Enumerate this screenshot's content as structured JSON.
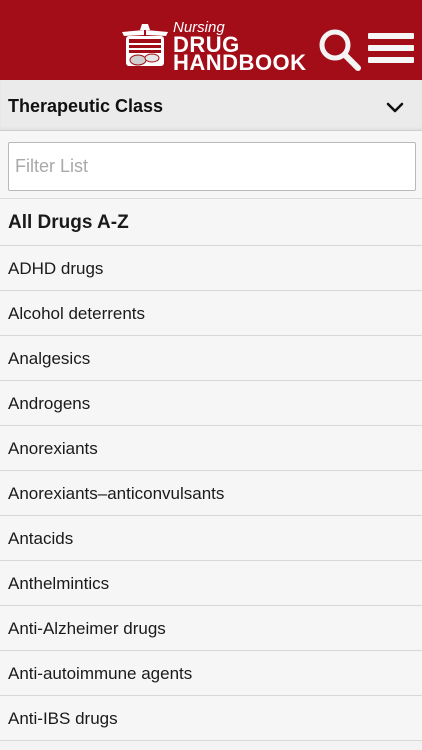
{
  "header": {
    "logo_small": "Nursing",
    "logo_line1": "DRUG",
    "logo_line2": "HANDBOOK",
    "bg_color": "#a30d18"
  },
  "icons": {
    "search": "search-icon",
    "menu": "hamburger-menu-icon",
    "dropdown": "chevron-down-icon"
  },
  "class_selector": {
    "label": "Therapeutic Class"
  },
  "filter": {
    "placeholder": "Filter List",
    "value": ""
  },
  "list": {
    "items": [
      "All Drugs A-Z",
      "ADHD drugs",
      "Alcohol deterrents",
      "Analgesics",
      "Androgens",
      "Anorexiants",
      "Anorexiants–anticonvulsants",
      "Antacids",
      "Anthelmintics",
      "Anti-Alzheimer drugs",
      "Anti-autoimmune agents",
      "Anti-IBS drugs"
    ]
  }
}
